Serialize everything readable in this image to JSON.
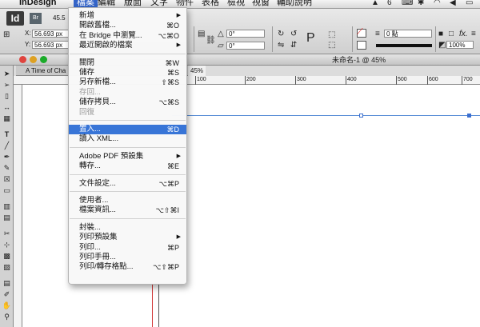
{
  "menubar": {
    "app_name": "InDesign",
    "menus": [
      "檔案",
      "編輯",
      "版面",
      "文字",
      "物件",
      "表格",
      "檢視",
      "視窗",
      "輔助說明"
    ],
    "status_badge": "6"
  },
  "toolbar": {
    "app_icon": "Id",
    "bridge_icon": "Br",
    "zoom_text": "45.5",
    "x_label": "X:",
    "y_label": "Y:",
    "x_value": "56.693 px",
    "y_value": "56.693 px",
    "angle_1": "0°",
    "angle_2": "0°",
    "zoom_percent": "100%",
    "stroke_weight": "0 點"
  },
  "window": {
    "title": "未命名-1 @ 45%",
    "doc_tab": "A Time of Cha",
    "doc_tab_zoom": "45%"
  },
  "ruler": {
    "labels": [
      "100",
      "200",
      "300",
      "400",
      "500",
      "600",
      "700"
    ]
  },
  "file_menu": {
    "items": [
      {
        "label": "新增",
        "shortcut": "",
        "submenu": true,
        "disabled": false,
        "highlighted": false
      },
      {
        "label": "開啟舊檔...",
        "shortcut": "⌘O",
        "submenu": false,
        "disabled": false,
        "highlighted": false
      },
      {
        "label": "在 Bridge 中瀏覽...",
        "shortcut": "⌥⌘O",
        "submenu": false,
        "disabled": false,
        "highlighted": false
      },
      {
        "label": "最近開啟的檔案",
        "shortcut": "",
        "submenu": true,
        "disabled": false,
        "highlighted": false
      },
      {
        "label": "關閉",
        "shortcut": "⌘W",
        "submenu": false,
        "disabled": false,
        "highlighted": false
      },
      {
        "label": "儲存",
        "shortcut": "⌘S",
        "submenu": false,
        "disabled": false,
        "highlighted": false
      },
      {
        "label": "另存新檔...",
        "shortcut": "⇧⌘S",
        "submenu": false,
        "disabled": false,
        "highlighted": false
      },
      {
        "label": "存回...",
        "shortcut": "",
        "submenu": false,
        "disabled": true,
        "highlighted": false
      },
      {
        "label": "儲存拷貝...",
        "shortcut": "⌥⌘S",
        "submenu": false,
        "disabled": false,
        "highlighted": false
      },
      {
        "label": "回復",
        "shortcut": "",
        "submenu": false,
        "disabled": true,
        "highlighted": false
      },
      {
        "label": "置入...",
        "shortcut": "⌘D",
        "submenu": false,
        "disabled": false,
        "highlighted": true
      },
      {
        "label": "讀入 XML...",
        "shortcut": "",
        "submenu": false,
        "disabled": false,
        "highlighted": false
      },
      {
        "label": "Adobe PDF 預設集",
        "shortcut": "",
        "submenu": true,
        "disabled": false,
        "highlighted": false
      },
      {
        "label": "轉存...",
        "shortcut": "⌘E",
        "submenu": false,
        "disabled": false,
        "highlighted": false
      },
      {
        "label": "文件設定...",
        "shortcut": "⌥⌘P",
        "submenu": false,
        "disabled": false,
        "highlighted": false
      },
      {
        "label": "使用者...",
        "shortcut": "",
        "submenu": false,
        "disabled": false,
        "highlighted": false
      },
      {
        "label": "檔案資訊...",
        "shortcut": "⌥⇧⌘I",
        "submenu": false,
        "disabled": false,
        "highlighted": false
      },
      {
        "label": "封裝...",
        "shortcut": "",
        "submenu": false,
        "disabled": false,
        "highlighted": false
      },
      {
        "label": "列印預設集",
        "shortcut": "",
        "submenu": true,
        "disabled": false,
        "highlighted": false
      },
      {
        "label": "列印...",
        "shortcut": "⌘P",
        "submenu": false,
        "disabled": false,
        "highlighted": false
      },
      {
        "label": "列印手冊...",
        "shortcut": "",
        "submenu": false,
        "disabled": false,
        "highlighted": false
      },
      {
        "label": "列印/轉存格點...",
        "shortcut": "⌥⇧⌘P",
        "submenu": false,
        "disabled": false,
        "highlighted": false
      }
    ]
  },
  "colors": {
    "highlight": "#3875d7",
    "menubar_active": "#3464c8",
    "guide": "#5a8ed6"
  }
}
